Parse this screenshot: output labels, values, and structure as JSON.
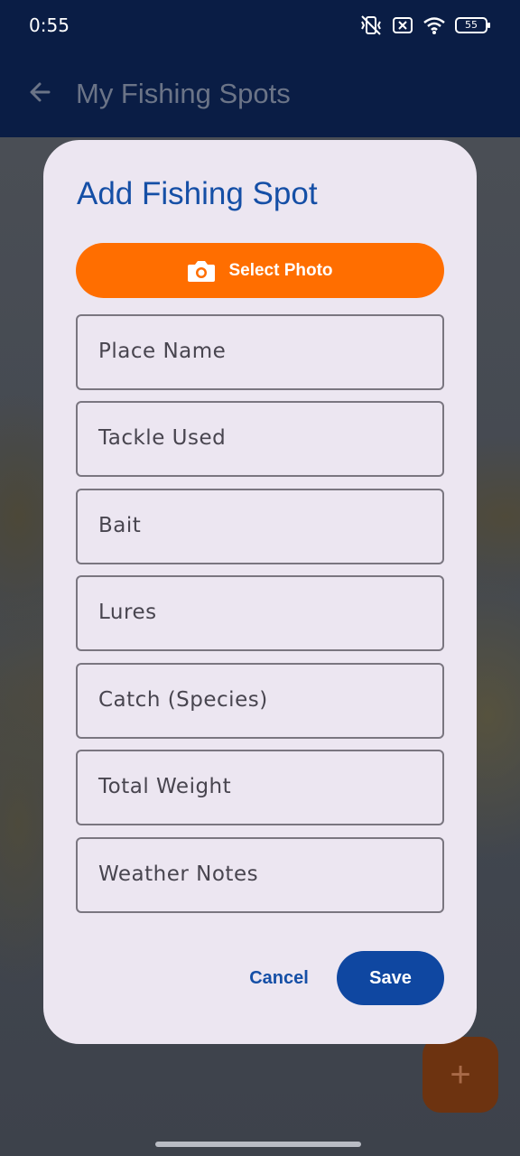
{
  "status_bar": {
    "time": "0:55",
    "battery": "55",
    "icons": [
      "vibrate-off-icon",
      "sim-blocked-icon",
      "wifi-icon",
      "battery-icon"
    ]
  },
  "app_bar": {
    "title": "My Fishing Spots",
    "back_icon": "arrow-left-icon"
  },
  "dialog": {
    "title": "Add Fishing Spot",
    "photo_button": {
      "label": "Select Photo",
      "icon": "camera-icon"
    },
    "fields": [
      {
        "label": "Place Name"
      },
      {
        "label": "Tackle Used"
      },
      {
        "label": "Bait"
      },
      {
        "label": "Lures"
      },
      {
        "label": "Catch (Species)"
      },
      {
        "label": "Total Weight"
      },
      {
        "label": "Weather Notes"
      }
    ],
    "cancel_label": "Cancel",
    "save_label": "Save"
  },
  "fab": {
    "label": "+",
    "icon": "plus-icon"
  },
  "colors": {
    "app_bar": "#0a1d45",
    "accent_orange": "#ff6e00",
    "primary_blue": "#0f47a1",
    "dialog_bg": "#ece6f1"
  }
}
